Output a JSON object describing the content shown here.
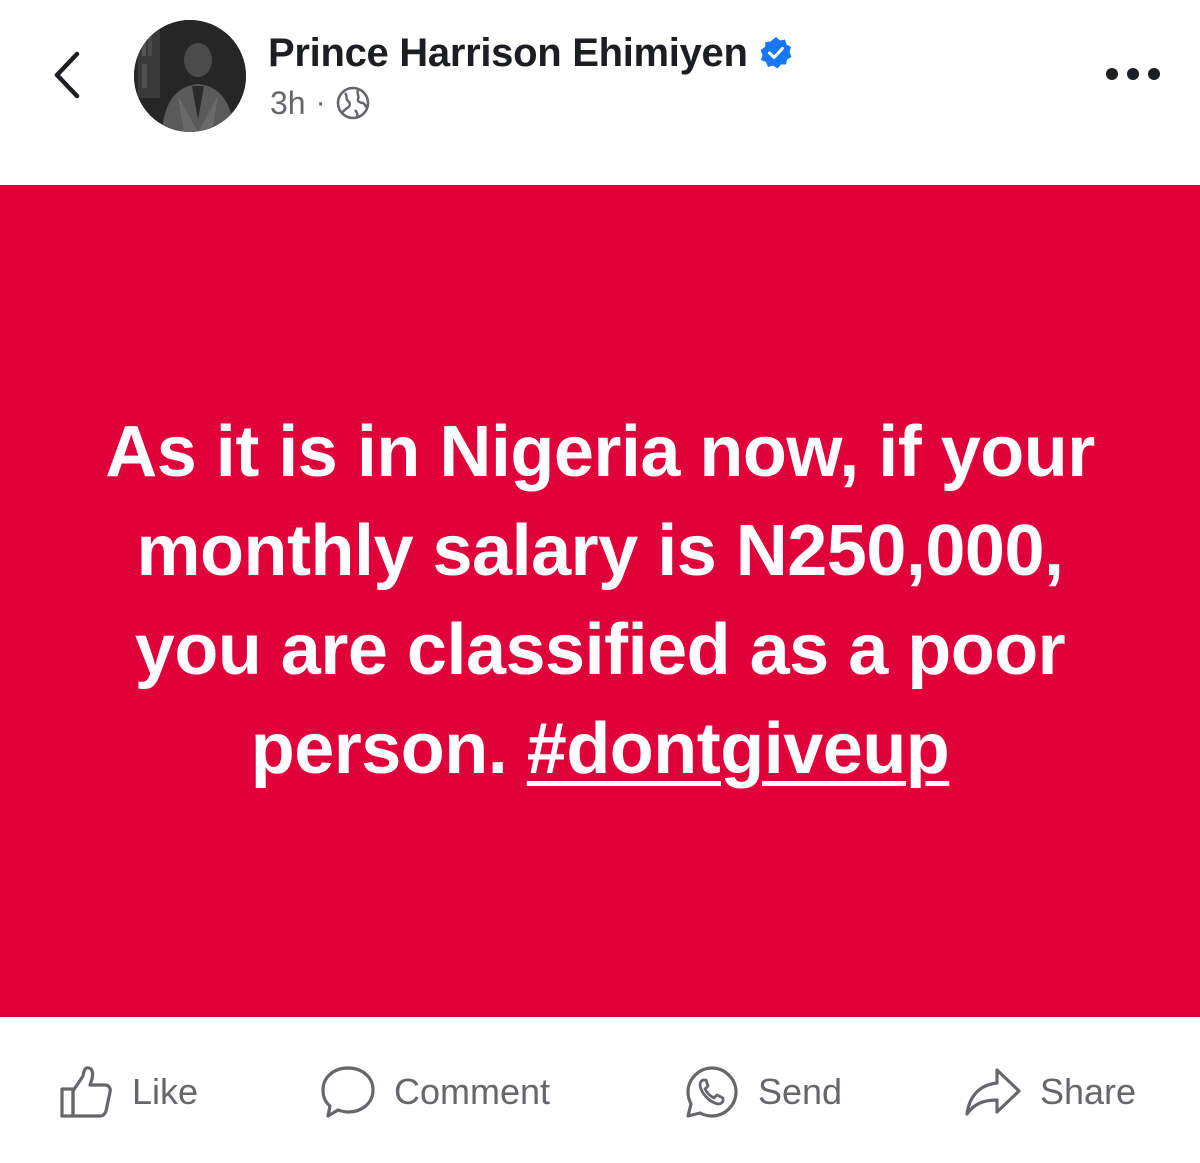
{
  "header": {
    "author_name": "Prince Harrison Ehimiyen",
    "time": "3h",
    "separator": "·"
  },
  "icons": {
    "back": "chevron-left-icon",
    "verified": "verified-badge-icon",
    "audience": "globe-icon",
    "more": "more-horizontal-icon",
    "like": "thumbs-up-icon",
    "comment": "comment-bubble-icon",
    "send": "whatsapp-icon",
    "share": "share-arrow-icon"
  },
  "post": {
    "text": "As it is in Nigeria now, if your monthly salary is N250,000, you are classified as a poor person. ",
    "hashtag": "#dontgiveup",
    "background_color": "#e0003a"
  },
  "actions": {
    "like": "Like",
    "comment": "Comment",
    "send": "Send",
    "share": "Share"
  },
  "colors": {
    "verified": "#1877f2",
    "text_primary": "#1c1e21",
    "text_secondary": "#65676b"
  }
}
